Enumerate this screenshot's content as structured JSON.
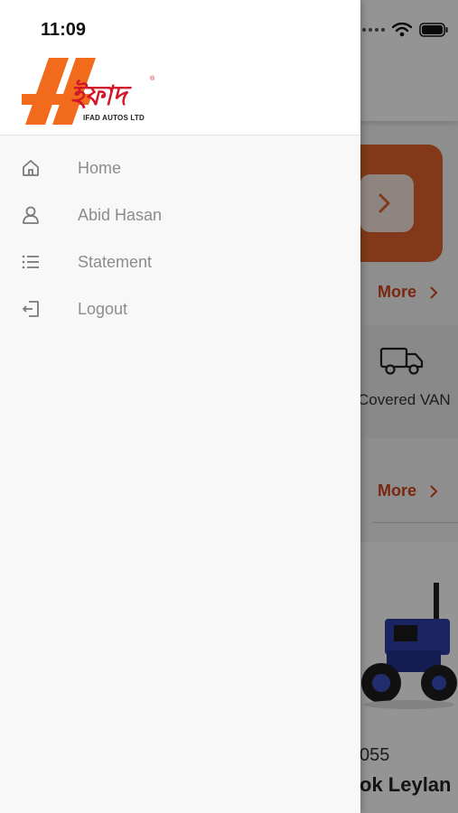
{
  "status_bar": {
    "time": "11:09"
  },
  "drawer": {
    "logo": {
      "bengali_text": "ইফাদ",
      "company": "IFAD AUTOS LTD",
      "colors": {
        "orange": "#f26b1d",
        "red": "#d1172a"
      }
    },
    "menu": [
      {
        "label": "Home",
        "icon": "home-icon"
      },
      {
        "label": "Abid Hasan",
        "icon": "user-icon"
      },
      {
        "label": "Statement",
        "icon": "list-icon"
      },
      {
        "label": "Logout",
        "icon": "logout-icon"
      }
    ]
  },
  "background": {
    "more_label_1": "More",
    "more_label_2": "More",
    "category_label": "Covered VAN",
    "product_model": "055",
    "product_brand": "ok Leylan",
    "accent": "#d4431a"
  }
}
